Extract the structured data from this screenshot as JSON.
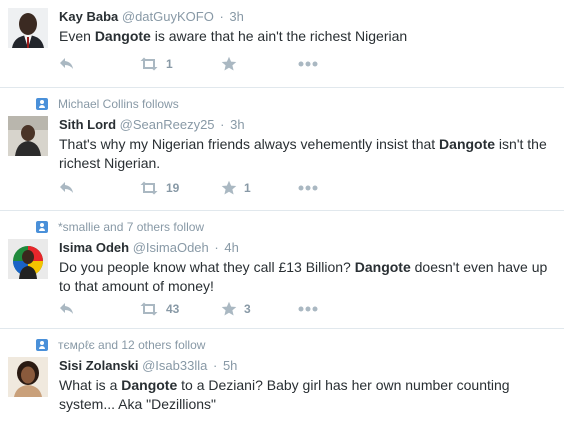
{
  "tweets": [
    {
      "context": "",
      "name": "Kay Baba",
      "handle": "@datGuyKOFO",
      "time": "3h",
      "text": [
        "Even ",
        "Dangote",
        " is aware that he ain't the richest Nigerian"
      ],
      "retweets": "1",
      "favorites": ""
    },
    {
      "context": "Michael Collins follows",
      "name": "Sith Lord",
      "handle": "@SeanReezy25",
      "time": "3h",
      "text": [
        "That's why my Nigerian friends always vehemently insist that ",
        "Dangote",
        " isn't the richest Nigerian."
      ],
      "retweets": "19",
      "favorites": "1"
    },
    {
      "context": "*smallie and 7 others follow",
      "name": "Isima Odeh",
      "handle": "@IsimaOdeh",
      "time": "4h",
      "text": [
        "Do you people know what they call £13 Billion? ",
        "Dangote",
        " doesn't even have up to that amount of money!"
      ],
      "retweets": "43",
      "favorites": "3"
    },
    {
      "context": "тємρℓє and 12 others follow",
      "name": "Sisi Zolanski",
      "handle": "@Isab33lla",
      "time": "5h",
      "text": [
        "What is a ",
        "Dangote",
        " to a Deziani? Baby girl has her own number counting system... Aka \"Dezillions\""
      ],
      "retweets": "",
      "favorites": ""
    }
  ],
  "icons": {
    "reply": "reply-icon",
    "retweet": "retweet-icon",
    "favorite": "star-icon",
    "more": "more-icon",
    "follow_context": "person-icon"
  },
  "colors": {
    "muted": "#8899a6",
    "icon": "#aab8c2",
    "context_icon": "#4a90d9",
    "divider": "#e1e8ed"
  }
}
